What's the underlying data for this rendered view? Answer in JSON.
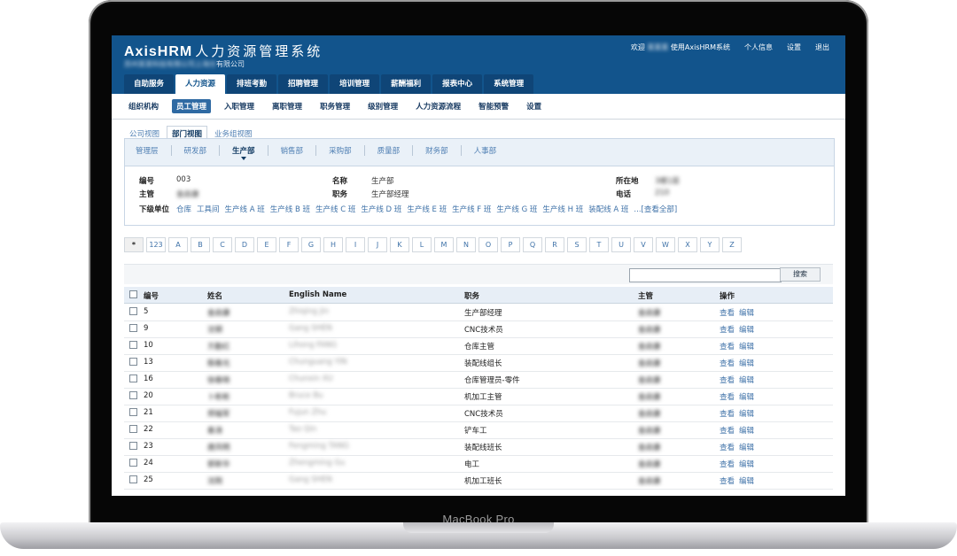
{
  "device": {
    "brand": "MacBook Pro"
  },
  "app": {
    "title_en": "AxisHRM",
    "title_cn": "人力资源管理系统",
    "company_blurred": "苏州某某科技有限公司上海分",
    "company_suffix": "有限公司"
  },
  "toplinks": {
    "welcome": "欢迎",
    "user_blurred": "某某某",
    "using": "使用AxisHRM系统",
    "profile": "个人信息",
    "settings": "设置",
    "logout": "退出"
  },
  "main_tabs": [
    "自助服务",
    "人力资源",
    "排班考勤",
    "招聘管理",
    "培训管理",
    "薪酬福利",
    "报表中心",
    "系统管理"
  ],
  "sub_nav": [
    "组织机构",
    "员工管理",
    "入职管理",
    "离职管理",
    "职务管理",
    "级别管理",
    "人力资源流程",
    "智能预警",
    "设置"
  ],
  "view_tabs": [
    "公司视图",
    "部门视图",
    "业务组视图"
  ],
  "departments": [
    "管理层",
    "研发部",
    "生产部",
    "销售部",
    "采购部",
    "质量部",
    "财务部",
    "人事部"
  ],
  "dept_info": {
    "code_label": "编号",
    "code": "003",
    "name_label": "名称",
    "name": "生产部",
    "location_label": "所在地",
    "location_blurred": "3楼1层",
    "manager_label": "主管",
    "manager_blurred": "金启康",
    "position_label": "职务",
    "position": "生产部经理",
    "phone_label": "电话",
    "phone_blurred": "210",
    "subunits_label": "下级单位",
    "subunits": [
      "仓库",
      "工具间",
      "生产线 A 班",
      "生产线 B 班",
      "生产线 C 班",
      "生产线 D 班",
      "生产线 E 班",
      "生产线 F 班",
      "生产线 G 班",
      "生产线 H 班",
      "装配线 A 班",
      "...[查看全部]"
    ]
  },
  "alphabet": [
    "*",
    "123",
    "A",
    "B",
    "C",
    "D",
    "E",
    "F",
    "G",
    "H",
    "I",
    "J",
    "K",
    "L",
    "M",
    "N",
    "O",
    "P",
    "Q",
    "R",
    "S",
    "T",
    "U",
    "V",
    "W",
    "X",
    "Y",
    "Z"
  ],
  "search": {
    "button": "搜索",
    "value": ""
  },
  "table": {
    "headers": {
      "id": "编号",
      "name": "姓名",
      "english": "English Name",
      "position": "职务",
      "manager": "主管",
      "action": "操作"
    },
    "rows": [
      {
        "id": "5",
        "name": "金启康",
        "english": "Zhiqing Jin",
        "position": "生产部经理",
        "manager": "金启康"
      },
      {
        "id": "9",
        "name": "沈钢",
        "english": "Gang SHEN",
        "position": "CNC技术员",
        "manager": "金启康"
      },
      {
        "id": "10",
        "name": "方勤红",
        "english": "Lihong FANG",
        "position": "仓库主管",
        "manager": "金启康"
      },
      {
        "id": "13",
        "name": "殷春光",
        "english": "Chunguang YIN",
        "position": "装配线组长",
        "manager": "金启康"
      },
      {
        "id": "16",
        "name": "徐春晓",
        "english": "Chunxin XU",
        "position": "仓库管理员-零件",
        "manager": "金启康"
      },
      {
        "id": "20",
        "name": "卜彬彬",
        "english": "Bruce Bu",
        "position": "机加工主管",
        "manager": "金启康"
      },
      {
        "id": "21",
        "name": "郑福军",
        "english": "Fujun Zhu",
        "position": "CNC技术员",
        "manager": "金启康"
      },
      {
        "id": "22",
        "name": "秦涛",
        "english": "Tao Qin",
        "position": "铲车工",
        "manager": "金启康"
      },
      {
        "id": "23",
        "name": "唐凤明",
        "english": "Fengming TANG",
        "position": "装配线班长",
        "manager": "金启康"
      },
      {
        "id": "24",
        "name": "郭新华",
        "english": "Zhengming Gu",
        "position": "电工",
        "manager": "金启康"
      },
      {
        "id": "25",
        "name": "沈刚",
        "english": "Gang SHEN",
        "position": "机加工班长",
        "manager": "金启康"
      }
    ],
    "view_label": "查看",
    "edit_label": "编辑"
  }
}
